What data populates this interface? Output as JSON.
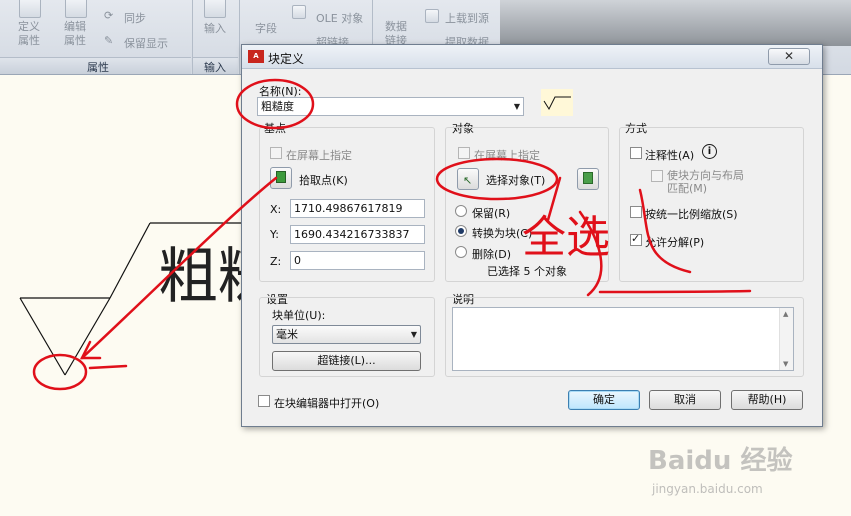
{
  "ribbon": {
    "define_attr": "定义\n属性",
    "edit_attr": "编辑\n属性",
    "sync": "同步",
    "keep_display": "保留显示",
    "attr_panel": "属性",
    "input": "输入",
    "input_panel": "输入",
    "field": "字段",
    "ole": "OLE 对象",
    "hyperlink": "超链接",
    "data_link": "数据\n链接",
    "upload": "上载到源",
    "extract": "提取数据"
  },
  "drawing": {
    "text": "粗糙"
  },
  "dialog": {
    "title": "块定义",
    "close": "✕",
    "name_label": "名称(N):",
    "name_value": "粗糙度",
    "basepoint": {
      "title": "基点",
      "on_screen": "在屏幕上指定",
      "pick": "拾取点(K)",
      "x_label": "X:",
      "x_value": "1710.49867617819",
      "y_label": "Y:",
      "y_value": "1690.434216733837",
      "z_label": "Z:",
      "z_value": "0"
    },
    "objects": {
      "title": "对象",
      "on_screen": "在屏幕上指定",
      "select": "选择对象(T)",
      "retain": "保留(R)",
      "convert": "转换为块(C)",
      "delete": "删除(D)",
      "selected_count": "已选择 5 个对象"
    },
    "behavior": {
      "title": "方式",
      "annotative": "注释性(A)",
      "match_orient": "使块方向与布局\n匹配(M)",
      "scale_uniform": "按统一比例缩放(S)",
      "allow_explode": "允许分解(P)"
    },
    "settings": {
      "title": "设置",
      "unit_label": "块单位(U):",
      "unit_value": "毫米",
      "hyperlink": "超链接(L)..."
    },
    "description": {
      "title": "说明"
    },
    "open_in_editor": "在块编辑器中打开(O)",
    "ok": "确定",
    "cancel": "取消",
    "help": "帮助(H)"
  },
  "annotations": {
    "handwriting": "全选"
  },
  "watermark": {
    "brand": "Baidu 经验",
    "url": "jingyan.baidu.com"
  },
  "colors": {
    "accent": "#3c7fb1",
    "annotation": "#e0101a",
    "canvas": "#fdfbf2"
  }
}
